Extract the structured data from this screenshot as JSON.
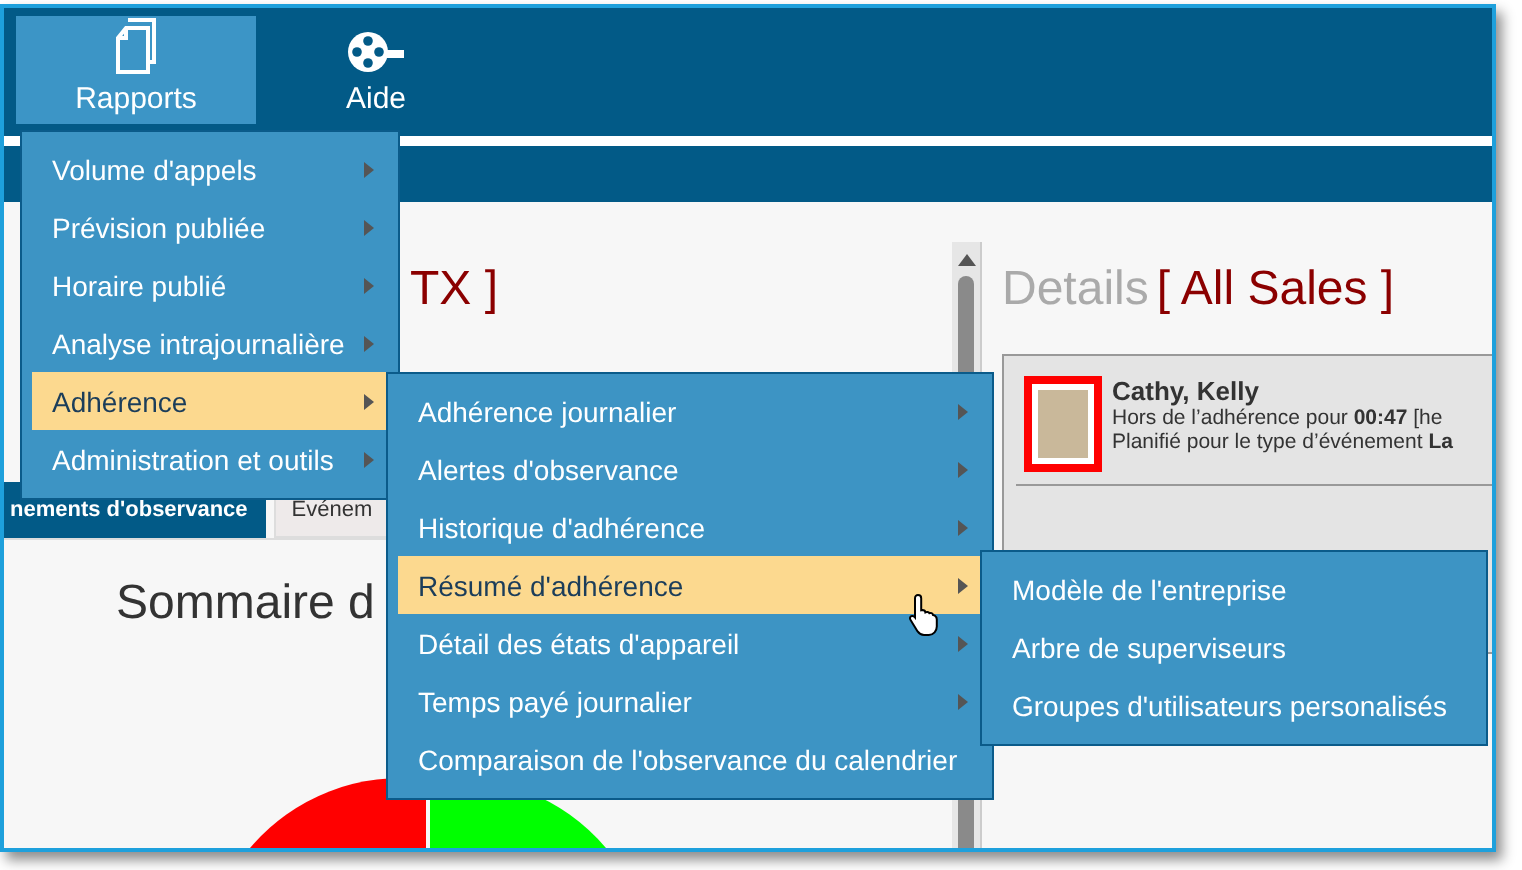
{
  "nav": [
    {
      "label": "Rapports",
      "selected": true
    },
    {
      "label": "Aide",
      "selected": false
    }
  ],
  "left_panel": {
    "title_context": "TX ]",
    "tabs": [
      {
        "label": "nements d'observance",
        "selected": true
      },
      {
        "label": "Événem",
        "selected": false
      }
    ],
    "summary_title": "Sommaire d"
  },
  "details": {
    "title": "Details",
    "context": "[ All Sales ]",
    "agents": [
      {
        "name": "Cathy, Kelly",
        "line_1": "Hors de l’adhérence pour **00:47** [he",
        "line_2": "Planifié pour le type d’événement **La**"
      }
    ]
  },
  "menus": [
    {
      "items": [
        {
          "label": "Volume d'appels",
          "submenu": true,
          "selected": false
        },
        {
          "label": "Prévision publiée",
          "submenu": true,
          "selected": false
        },
        {
          "label": "Horaire publié",
          "submenu": true,
          "selected": false
        },
        {
          "label": "Analyse intrajournalière",
          "submenu": true,
          "selected": false
        },
        {
          "label": "Adhérence",
          "submenu": true,
          "selected": true
        },
        {
          "label": "Administration et outils",
          "submenu": true,
          "selected": false
        }
      ]
    },
    {
      "items": [
        {
          "label": "Adhérence journalier",
          "submenu": true,
          "selected": false
        },
        {
          "label": "Alertes d'observance",
          "submenu": true,
          "selected": false
        },
        {
          "label": "Historique d'adhérence",
          "submenu": true,
          "selected": false
        },
        {
          "label": "Résumé d'adhérence",
          "submenu": true,
          "selected": true
        },
        {
          "label": "Détail des états d'appareil",
          "submenu": true,
          "selected": false
        },
        {
          "label": "Temps payé journalier",
          "submenu": true,
          "selected": false
        },
        {
          "label": "Comparaison de l'observance du calendrier",
          "submenu": false,
          "selected": false
        }
      ]
    },
    {
      "items": [
        {
          "label": "Modèle de l'entreprise",
          "submenu": false,
          "selected": false
        },
        {
          "label": "Arbre de superviseurs",
          "submenu": false,
          "selected": false
        },
        {
          "label": "Groupes d'utilisateurs personalisés",
          "submenu": false,
          "selected": false
        }
      ]
    }
  ]
}
